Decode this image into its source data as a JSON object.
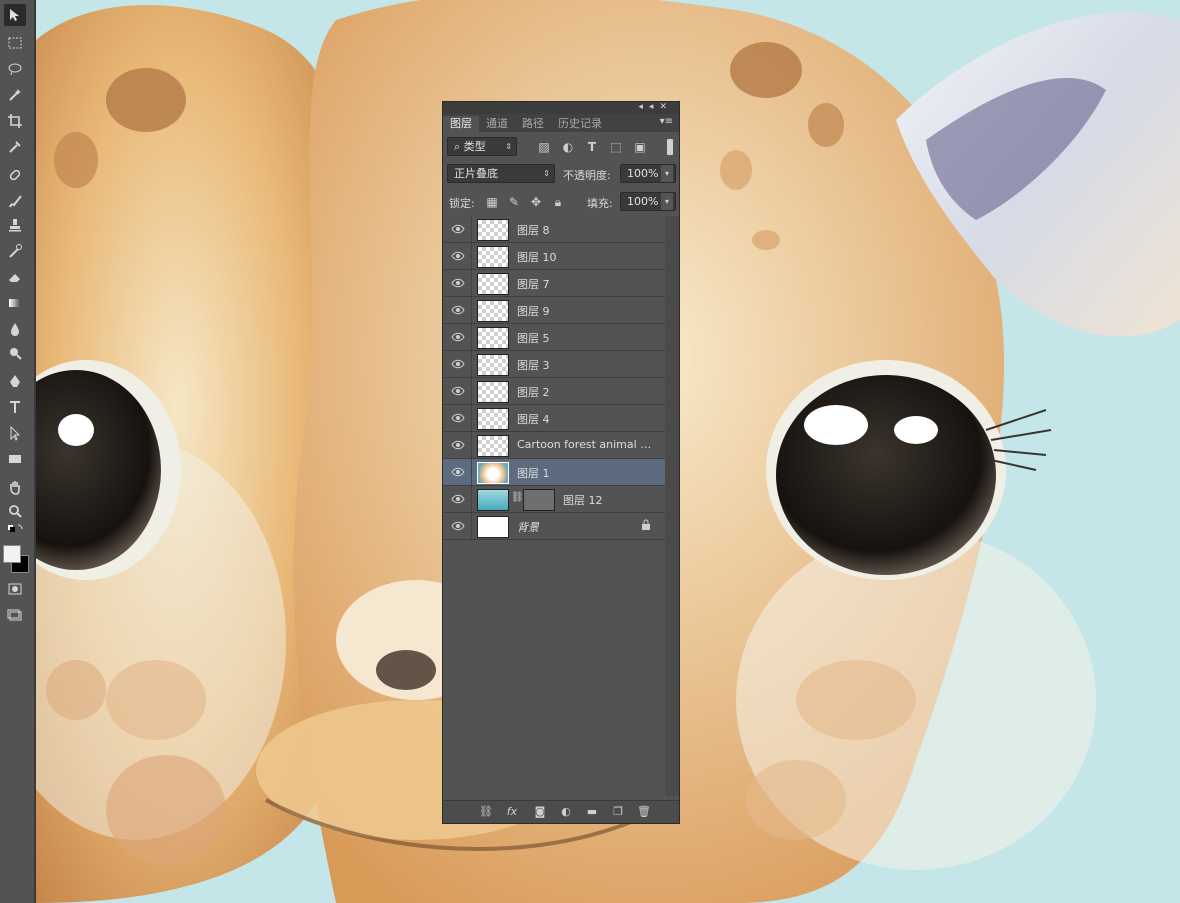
{
  "panel": {
    "tabs": [
      {
        "label": "图层",
        "active": true
      },
      {
        "label": "通道",
        "active": false
      },
      {
        "label": "路径",
        "active": false
      },
      {
        "label": "历史记录",
        "active": false
      }
    ],
    "filter_kind": "类型",
    "blend_mode": "正片叠底",
    "opacity_label": "不透明度:",
    "opacity_value": "100%",
    "lock_label": "锁定:",
    "fill_label": "填充:",
    "fill_value": "100%",
    "layers": [
      {
        "name": "图层 8"
      },
      {
        "name": "图层 10"
      },
      {
        "name": "图层 7"
      },
      {
        "name": "图层 9"
      },
      {
        "name": "图层 5"
      },
      {
        "name": "图层 3"
      },
      {
        "name": "图层 2"
      },
      {
        "name": "图层 4"
      },
      {
        "name": "Cartoon forest animal p..."
      },
      {
        "name": "图层 1",
        "selected": true
      },
      {
        "name": "图层 12"
      },
      {
        "name": "背景",
        "locked": true
      }
    ]
  },
  "colors": {
    "accent_selected": "#5d6b80",
    "panel_bg": "#535353",
    "canvas_bg": "#bfe3e6"
  }
}
